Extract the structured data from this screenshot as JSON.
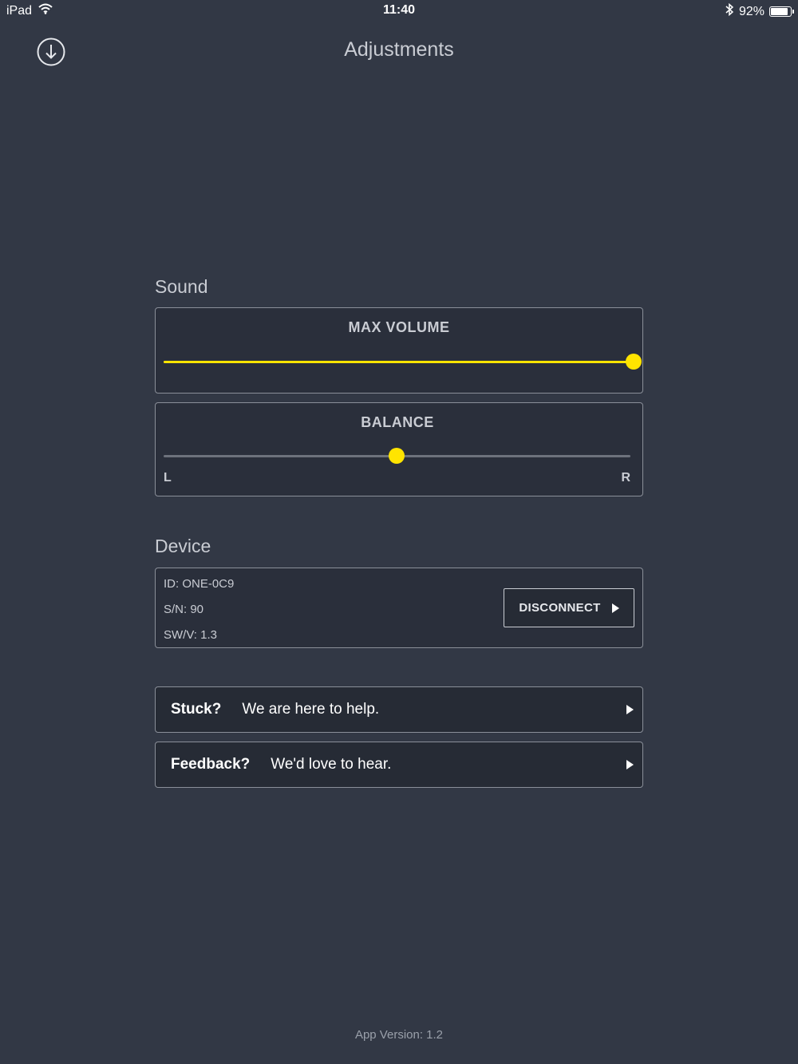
{
  "status_bar": {
    "device": "iPad",
    "time": "11:40",
    "battery_text": "92%",
    "battery_level": 0.92
  },
  "header": {
    "title": "Adjustments"
  },
  "sound": {
    "section_title": "Sound",
    "max_volume": {
      "label": "MAX VOLUME",
      "value": 1.0,
      "accent": "#ffe400"
    },
    "balance": {
      "label": "BALANCE",
      "value": 0.5,
      "left_label": "L",
      "right_label": "R",
      "accent": "#ffe400"
    }
  },
  "device": {
    "section_title": "Device",
    "id": "ID: ONE-0C9",
    "sn": "S/N: 90",
    "swv": "SW/V: 1.3",
    "disconnect_label": "DISCONNECT"
  },
  "links": [
    {
      "bold": "Stuck?",
      "text": "We are here to help."
    },
    {
      "bold": "Feedback?",
      "text": "We'd love to hear."
    }
  ],
  "footer": {
    "app_version": "App Version: 1.2"
  },
  "colors": {
    "background": "#323845",
    "panel": "#2a2f3b",
    "accent": "#ffe400",
    "track_inactive": "#6d727c"
  },
  "icons": {
    "download": "download-circle-icon",
    "wifi": "wifi-icon",
    "bluetooth": "bluetooth-icon",
    "battery": "battery-icon",
    "chevron": "play-triangle-icon"
  }
}
